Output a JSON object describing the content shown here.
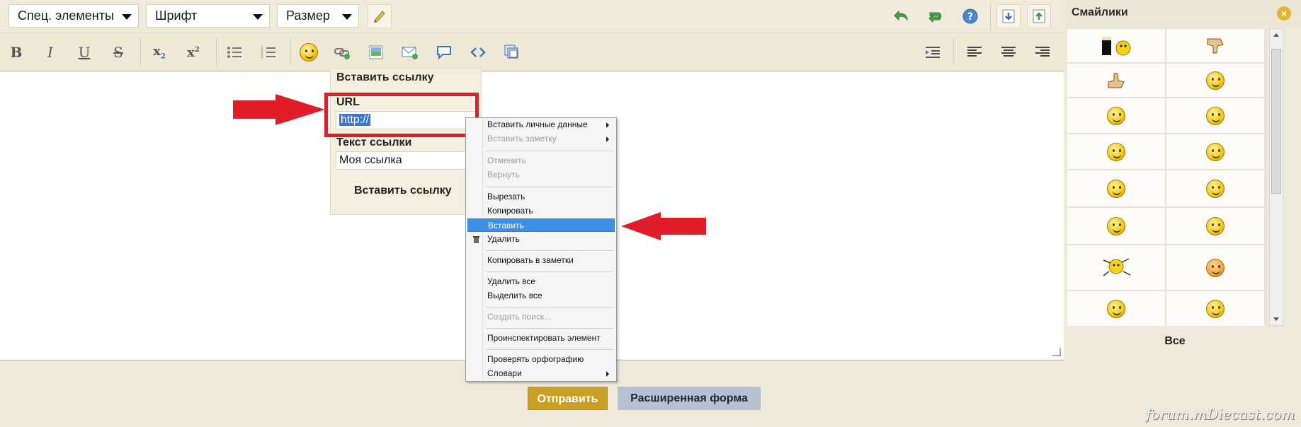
{
  "toolbar": {
    "special_elements": "Спец. элементы",
    "font": "Шрифт",
    "size": "Размер"
  },
  "link_popup": {
    "title": "Вставить ссылку",
    "url_label": "URL",
    "url_value": "http://",
    "text_label": "Текст ссылки",
    "text_value": "Моя ссылка",
    "insert_button": "Вставить ссылку"
  },
  "context_menu": {
    "items": [
      {
        "label": "Вставить личные данные",
        "disabled": false,
        "submenu": true
      },
      {
        "label": "Вставить заметку",
        "disabled": true,
        "submenu": true
      },
      {
        "label": "Отменить",
        "disabled": true
      },
      {
        "label": "Вернуть",
        "disabled": true
      },
      {
        "label": "Вырезать",
        "disabled": false
      },
      {
        "label": "Копировать",
        "disabled": false
      },
      {
        "label": "Вставить",
        "disabled": false,
        "highlighted": true
      },
      {
        "label": "Удалить",
        "disabled": false,
        "icon": "trash-icon"
      },
      {
        "label": "Копировать в заметки",
        "disabled": false
      },
      {
        "label": "Удалить все",
        "disabled": false
      },
      {
        "label": "Выделить все",
        "disabled": false
      },
      {
        "label": "Создать поиск...",
        "disabled": true
      },
      {
        "label": "Проинспектировать элемент",
        "disabled": false
      },
      {
        "label": "Проверять орфографию",
        "disabled": false
      },
      {
        "label": "Словари",
        "disabled": false,
        "submenu": true
      }
    ]
  },
  "actions": {
    "send": "Отправить",
    "extended_form": "Расширенная форма"
  },
  "smileys_panel": {
    "title": "Смайлики",
    "all_label": "Все"
  },
  "watermark": "forum.mDiecast.com",
  "colors": {
    "annotation_red": "#e01d28",
    "highlight_blue": "#3d8fe6",
    "send_button": "#c9a024",
    "extended_button": "#b5c1d2"
  }
}
